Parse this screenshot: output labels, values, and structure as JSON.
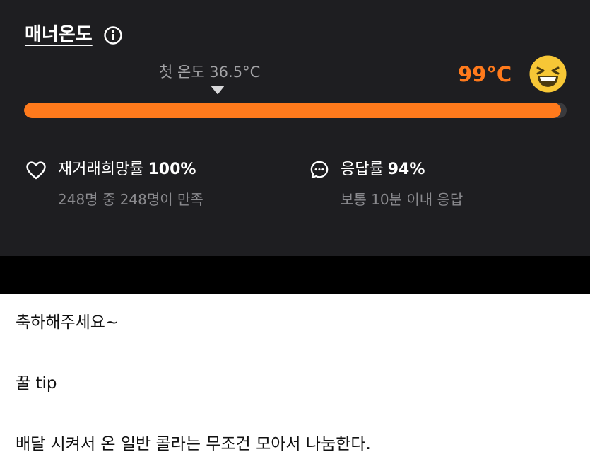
{
  "manner": {
    "title": "매너온도",
    "first_temp_label": "첫 온도 36.5°C",
    "current_temp": "99°C",
    "temperature_level": 0.99
  },
  "stats": [
    {
      "icon": "heart-icon",
      "label": "재거래희망률",
      "value": "100%",
      "sub": "248명 중 248명이 만족"
    },
    {
      "icon": "chat-bubble-icon",
      "label": "응답률",
      "value": "94%",
      "sub": "보통 10분 이내 응답"
    }
  ],
  "post": {
    "lines": [
      "축하해주세요~",
      "꿀 tip",
      "배달 시켜서 온 일반 콜라는 무조건 모아서 나눔한다."
    ]
  },
  "colors": {
    "accent": "#ff7a1c",
    "panel_bg": "#1e1e21",
    "emoji_yellow": "#f7c736"
  }
}
